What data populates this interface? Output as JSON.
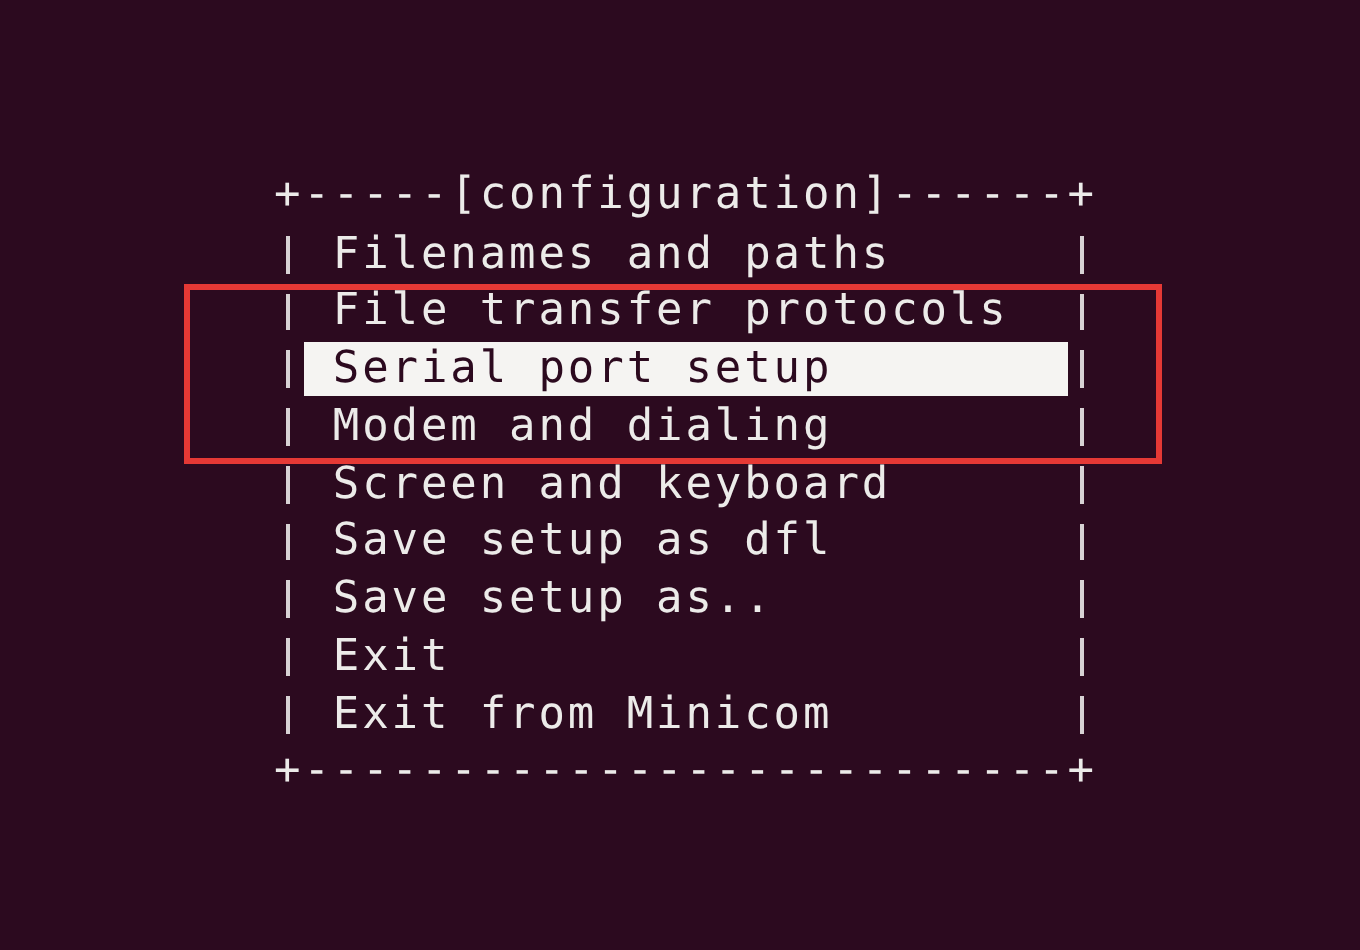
{
  "menu": {
    "top_border": "+-----[configuration]------+",
    "items": [
      {
        "label": "Filenames and paths",
        "selected": false
      },
      {
        "label": "File transfer protocols",
        "selected": false
      },
      {
        "label": "Serial port setup",
        "selected": true
      },
      {
        "label": "Modem and dialing",
        "selected": false
      },
      {
        "label": "Screen and keyboard",
        "selected": false
      },
      {
        "label": "Save setup as dfl",
        "selected": false
      },
      {
        "label": "Save setup as..",
        "selected": false
      },
      {
        "label": "Exit",
        "selected": false
      },
      {
        "label": "Exit from Minicom",
        "selected": false
      }
    ],
    "bottom_border": "+--------------------------+"
  },
  "annotations": [
    {
      "kind": "rectangle"
    }
  ]
}
